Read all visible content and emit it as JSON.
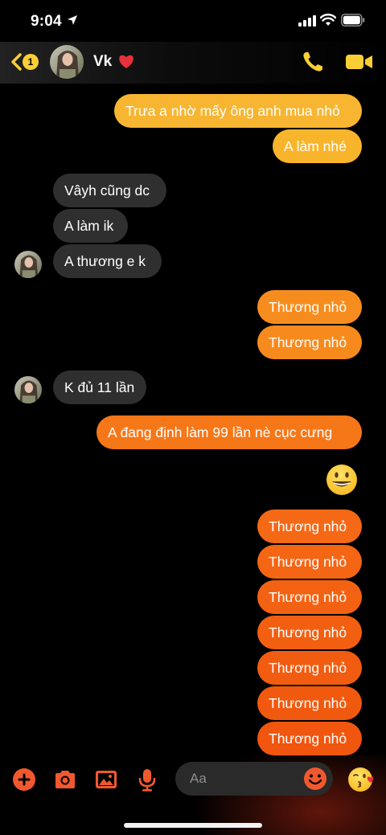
{
  "status": {
    "time": "9:04"
  },
  "header": {
    "back_badge": "1",
    "contact_name": "Vk",
    "heart_icon": "red-heart-emoji"
  },
  "messages": [
    {
      "dir": "sent",
      "text": "Trưa a nhờ mấy ông anh mua nhỏ",
      "color": "#f7b532"
    },
    {
      "dir": "sent",
      "text": "A làm nhé",
      "color": "#f8b52b"
    },
    {
      "dir": "recv",
      "text": "Vâyh cũng dc"
    },
    {
      "dir": "recv",
      "text": "A làm ik"
    },
    {
      "dir": "recv",
      "text": "A thương e k"
    },
    {
      "dir": "sent",
      "text": "Thương nhỏ",
      "color": "#f78c1e"
    },
    {
      "dir": "sent",
      "text": "Thương nhỏ",
      "color": "#f78a1d"
    },
    {
      "dir": "recv",
      "text": "K đủ 11 lần"
    },
    {
      "dir": "sent",
      "text": "A đang định làm 99 lần nè cục cưng",
      "color": "#f67718"
    },
    {
      "dir": "sent",
      "text": "Thương nhỏ",
      "color": "#f46816"
    },
    {
      "dir": "sent",
      "text": "Thương nhỏ",
      "color": "#f46514"
    },
    {
      "dir": "sent",
      "text": "Thương nhỏ",
      "color": "#f36212"
    },
    {
      "dir": "sent",
      "text": "Thương nhỏ",
      "color": "#f25f11"
    },
    {
      "dir": "sent",
      "text": "Thương nhỏ",
      "color": "#f25c10"
    },
    {
      "dir": "sent",
      "text": "Thương nhỏ",
      "color": "#f1590f"
    },
    {
      "dir": "sent",
      "text": "Thương nhỏ",
      "color": "#f0560e"
    }
  ],
  "big_emoji": "grinning-face-emoji",
  "composer": {
    "placeholder": "Aa",
    "accent": "#f2582e"
  },
  "colors": {
    "header_accent": "#f9cf35",
    "recv_bubble": "#2f2f2f"
  }
}
